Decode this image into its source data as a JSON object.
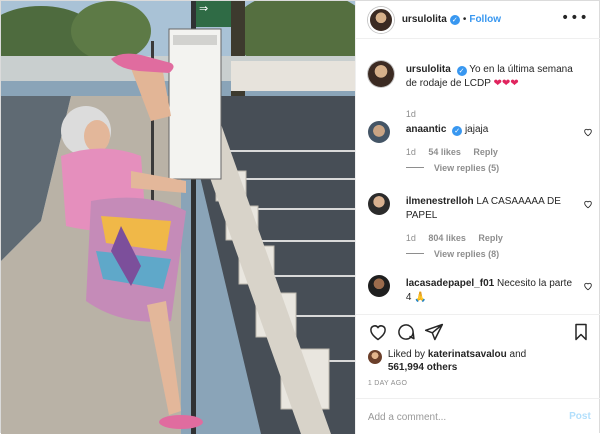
{
  "header": {
    "username": "ursulolita",
    "dot": "•",
    "follow_label": "Follow",
    "more_icon": "more-options-icon"
  },
  "photo": {
    "sign_arrow": "⇒"
  },
  "caption": {
    "username": "ursulolita",
    "text": "Yo en la última semana de rodaje de LCDP",
    "emoji": "❤❤❤",
    "time": "1d"
  },
  "comments": [
    {
      "username": "anaantic",
      "verified": true,
      "text": "jajaja",
      "time": "1d",
      "likes": "54 likes",
      "reply": "Reply",
      "view_replies": "View replies (5)"
    },
    {
      "username": "ilmenestrelloh",
      "verified": false,
      "text": "LA CASAAAAA DE PAPEL",
      "time": "1d",
      "likes": "804 likes",
      "reply": "Reply",
      "view_replies": "View replies (8)"
    },
    {
      "username": "lacasadepapel_f01",
      "verified": false,
      "text": "Necesito la parte 4 🙏"
    }
  ],
  "likes": {
    "prefix": "Liked by ",
    "user": "katerinatsavalou",
    "and": " and",
    "count": "561,994 others"
  },
  "timestamp": "1 DAY AGO",
  "add_comment": {
    "placeholder": "Add a comment...",
    "post_label": "Post"
  },
  "colors": {
    "accent": "#3897f0",
    "heart": "#e0245e",
    "muted": "#8e8e8e"
  }
}
